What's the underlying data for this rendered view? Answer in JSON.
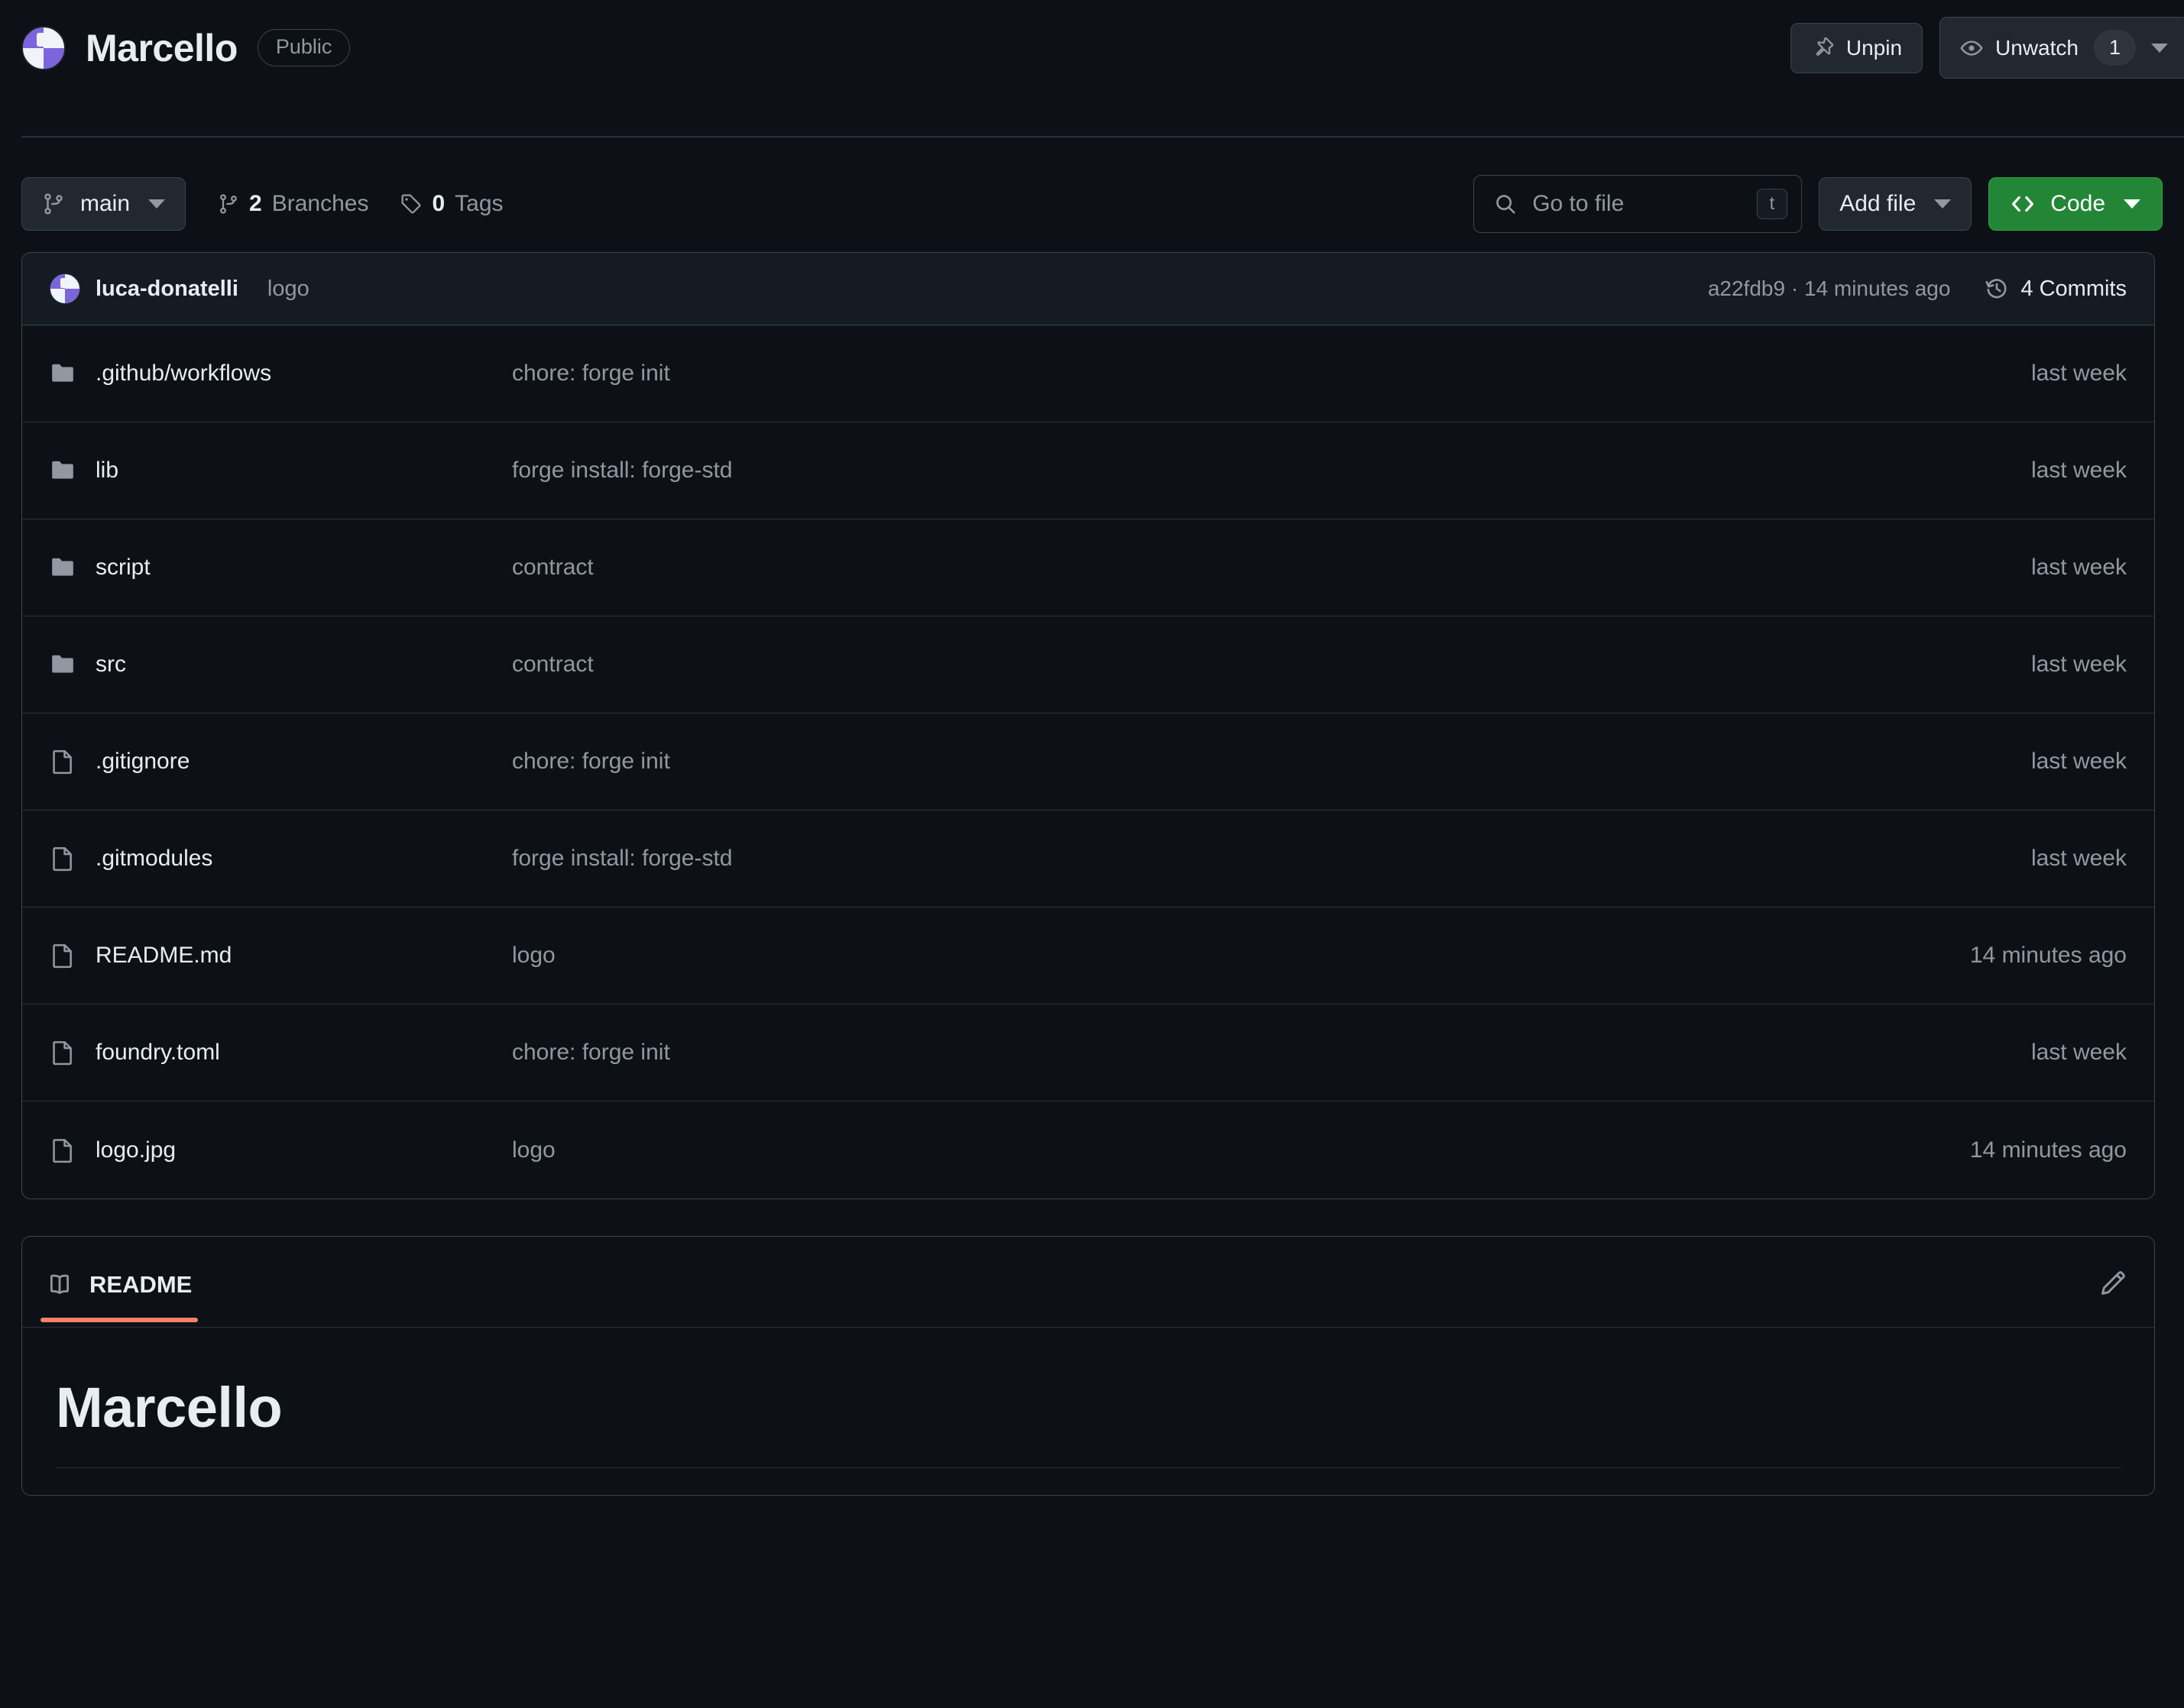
{
  "header": {
    "repo_name": "Marcello",
    "visibility": "Public",
    "avatar_icon": "repo-owner-avatar",
    "actions": [
      {
        "id": "unpin",
        "label": "Unpin",
        "icon": "pin-icon"
      },
      {
        "id": "unwatch",
        "label": "Unwatch",
        "icon": "eye-icon",
        "count": "1"
      }
    ]
  },
  "toolbar": {
    "branch": {
      "label": "main",
      "icon": "git-branch-icon"
    },
    "branches": {
      "count": "2",
      "label": "Branches",
      "icon": "git-branch-icon"
    },
    "tags": {
      "count": "0",
      "label": "Tags",
      "icon": "tag-icon"
    },
    "search": {
      "placeholder": "Go to file",
      "shortcut": "t",
      "icon": "search-icon"
    },
    "add_file": {
      "label": "Add file"
    },
    "code": {
      "label": "Code",
      "icon": "code-icon",
      "color": "#238636"
    }
  },
  "commit_bar": {
    "author": "luca-donatelli",
    "message": "logo",
    "hash": "a22fdb9",
    "separator": "·",
    "relative_time": "14 minutes ago",
    "commits_label": "4 Commits",
    "history_icon": "history-icon"
  },
  "file_table": {
    "rows": [
      {
        "name": ".github/workflows",
        "type": "folder",
        "message": "chore: forge init",
        "time": "last week"
      },
      {
        "name": "lib",
        "type": "folder",
        "message": "forge install: forge-std",
        "time": "last week"
      },
      {
        "name": "script",
        "type": "folder",
        "message": "contract",
        "time": "last week"
      },
      {
        "name": "src",
        "type": "folder",
        "message": "contract",
        "time": "last week"
      },
      {
        "name": ".gitignore",
        "type": "file",
        "message": "chore: forge init",
        "time": "last week"
      },
      {
        "name": ".gitmodules",
        "type": "file",
        "message": "forge install: forge-std",
        "time": "last week"
      },
      {
        "name": "README.md",
        "type": "file",
        "message": "logo",
        "time": "14 minutes ago"
      },
      {
        "name": "foundry.toml",
        "type": "file",
        "message": "chore: forge init",
        "time": "last week"
      },
      {
        "name": "logo.jpg",
        "type": "file",
        "message": "logo",
        "time": "14 minutes ago"
      }
    ]
  },
  "readme": {
    "tab_label": "README",
    "tab_icon": "book-icon",
    "edit_icon": "pencil-icon",
    "accent_color": "#f78166",
    "heading": "Marcello"
  }
}
